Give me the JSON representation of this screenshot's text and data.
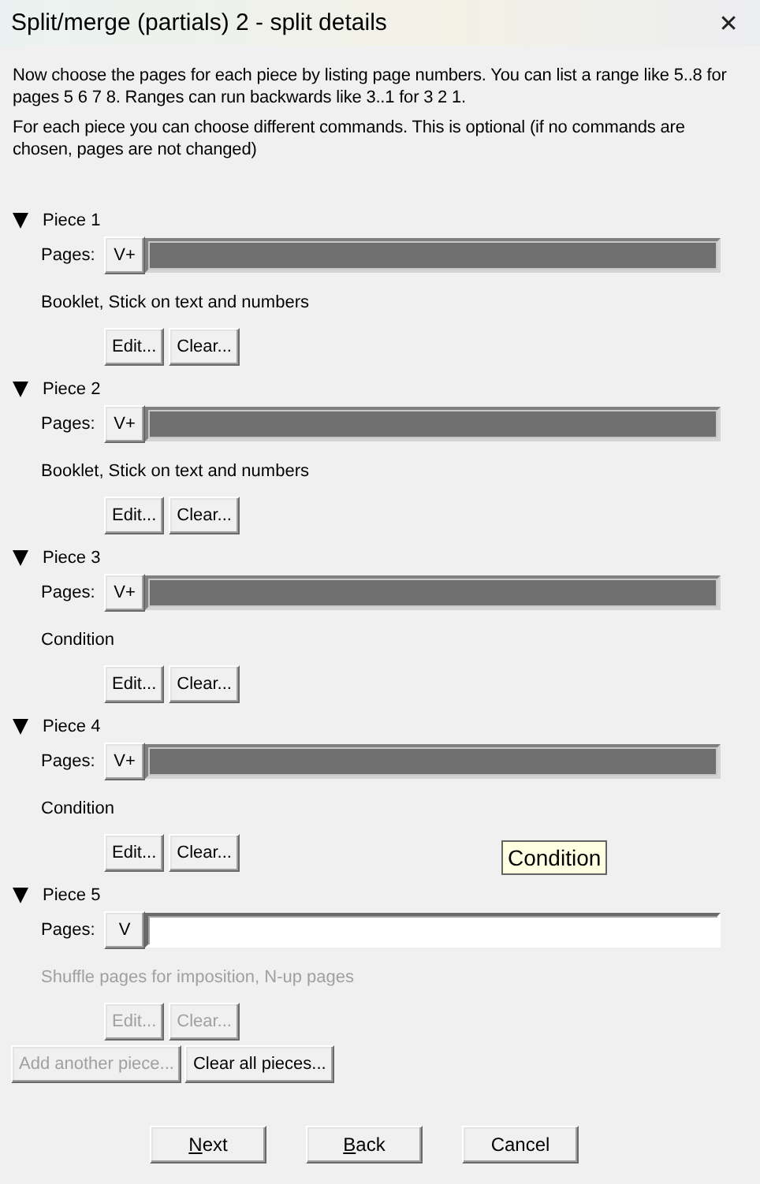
{
  "window": {
    "title": "Split/merge (partials) 2 - split details",
    "close": "✕"
  },
  "intro": [
    "Now choose the pages for each piece by listing page numbers. You can list a range like 5..8 for pages 5 6 7 8. Ranges can run backwards like 3..1 for 3 2 1.",
    "For each piece you can choose different commands. This is optional (if no commands are chosen, pages are not changed)"
  ],
  "pieces": [
    {
      "title": "Piece 1",
      "expanded": true,
      "pages_label": "Pages:",
      "view_button": "V+",
      "pages_selected": true,
      "commands": "Booklet, Stick on text and numbers",
      "disabled": false,
      "edit": "Edit...",
      "clear": "Clear..."
    },
    {
      "title": "Piece 2",
      "expanded": true,
      "pages_label": "Pages:",
      "view_button": "V+",
      "pages_selected": true,
      "commands": "Booklet, Stick on text and numbers",
      "disabled": false,
      "edit": "Edit...",
      "clear": "Clear..."
    },
    {
      "title": "Piece 3",
      "expanded": true,
      "pages_label": "Pages:",
      "view_button": "V+",
      "pages_selected": true,
      "commands": "Condition",
      "disabled": false,
      "edit": "Edit...",
      "clear": "Clear..."
    },
    {
      "title": "Piece 4",
      "expanded": true,
      "pages_label": "Pages:",
      "view_button": "V+",
      "pages_selected": true,
      "commands": "Condition",
      "disabled": false,
      "edit": "Edit...",
      "clear": "Clear..."
    },
    {
      "title": "Piece 5",
      "expanded": true,
      "pages_label": "Pages:",
      "view_button": "V",
      "pages_selected": false,
      "commands": "Shuffle pages for imposition, N-up pages",
      "disabled": true,
      "edit": "Edit...",
      "clear": "Clear..."
    }
  ],
  "piece_actions": [
    {
      "label": "Add another piece...",
      "disabled": true
    },
    {
      "label": "Clear all pieces...",
      "disabled": false
    }
  ],
  "tooltip": "Condition",
  "footer_buttons": [
    {
      "label": "Next",
      "underline_first": true
    },
    {
      "label": "Back",
      "underline_first": true
    },
    {
      "label": "Cancel",
      "underline_first": false
    }
  ]
}
